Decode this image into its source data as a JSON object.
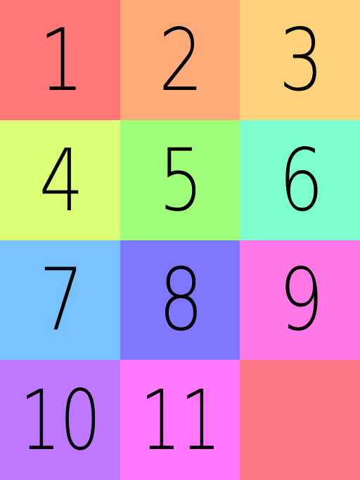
{
  "puzzle": {
    "tiles": [
      {
        "label": "1",
        "color": "#ff7878"
      },
      {
        "label": "2",
        "color": "#ffaa78"
      },
      {
        "label": "3",
        "color": "#ffd27d"
      },
      {
        "label": "4",
        "color": "#dcff78"
      },
      {
        "label": "5",
        "color": "#a0ff78"
      },
      {
        "label": "6",
        "color": "#7dffcd"
      },
      {
        "label": "7",
        "color": "#78c3ff"
      },
      {
        "label": "8",
        "color": "#7d78ff"
      },
      {
        "label": "9",
        "color": "#ff78e6"
      },
      {
        "label": "10",
        "color": "#be78ff"
      },
      {
        "label": "11",
        "color": "#ff78ff"
      },
      {
        "label": "",
        "color": "#ff7887"
      }
    ]
  }
}
